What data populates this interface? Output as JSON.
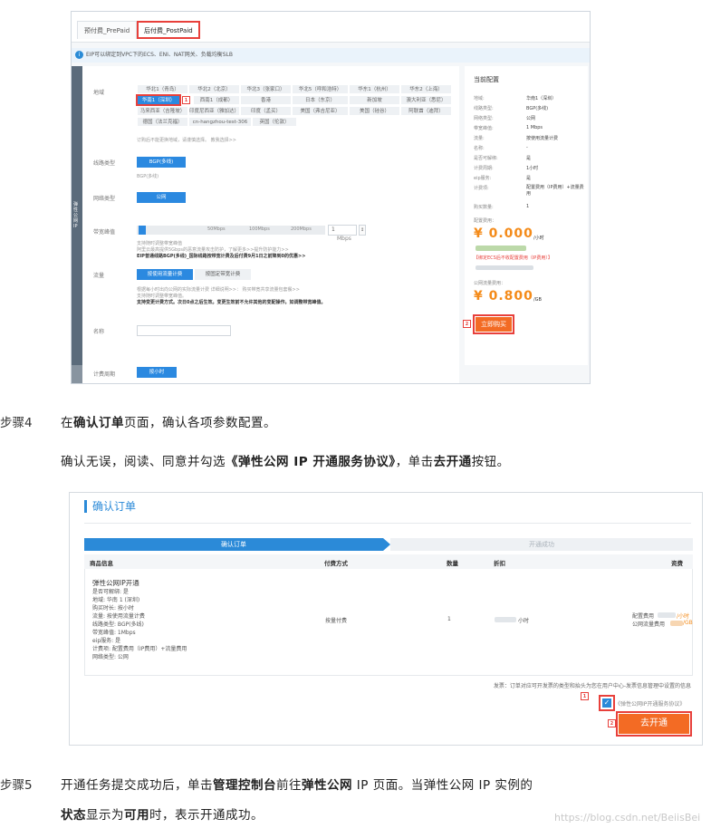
{
  "shot1": {
    "tabs": [
      "预付费_PrePaid",
      "后付费_PostPaid"
    ],
    "notice": "EIP可以绑定到VPC下的ECS、ENI、NAT网关、负载均衡SLB",
    "side_label": "弹性公网IP",
    "labels": {
      "region": "地域",
      "line_type": "线路类型",
      "network_type": "网络类型",
      "bandwidth": "带宽峰值",
      "traffic": "流量",
      "name": "名称",
      "billing_cycle": "计费周期"
    },
    "regions": [
      [
        "华北1（青岛）",
        "华北2（北京）",
        "华北3（张家口）",
        "华北5（呼和浩特）",
        "华东1（杭州）",
        "华东2（上海）"
      ],
      [
        "华南1（深圳）",
        "西南1（成都）",
        "香港",
        "日本（东京）",
        "新加坡",
        "澳大利亚（悉尼）"
      ],
      [
        "马来西亚（吉隆坡）",
        "印度尼西亚（雅加达）",
        "印度（孟买）",
        "美国（弗吉尼亚）",
        "美国（硅谷）",
        "阿联酋（迪拜）"
      ],
      [
        "德国（法兰克福）",
        "cn-hangzhou-test-306",
        "英国（伦敦）"
      ]
    ],
    "region_note": "订购后不能更换地域，请谨慎选择。 教我选择>>",
    "line_btn": "BGP(多线)",
    "line_value": "BGP(多线)",
    "network_btn": "公网",
    "slider_ticks": [
      "50Mbps",
      "100Mbps",
      "200Mbps"
    ],
    "bandwidth_value": "1",
    "bandwidth_unit": "Mbps",
    "bandwidth_hints": [
      "支持随时调整带宽峰值",
      "阿里云最高提供5Gbps的恶意流量攻击防护，了解更多>>提升防护能力>>",
      "EIP普通线路BGP(多线)_国际线路按带宽计费及后付费9月1日之前降到0的优惠>>"
    ],
    "traffic_btns": [
      "按使用流量计费",
      "按固定带宽计费"
    ],
    "traffic_hints": [
      "根据每小时出向公网的实际流量计费 详细说明>>： 购买带宽共享流量包套餐>>",
      "支持随时调整带宽峰值。",
      "支持变更计费方式。次日0点之后生效。变更生效前不允许其他的变配操作。如调整带宽峰值。"
    ],
    "billing_btn": "按小时",
    "summary": {
      "title": "当前配置",
      "rows": [
        [
          "地域:",
          "华南1（深圳）"
        ],
        [
          "线路类型:",
          "BGP(多线)"
        ],
        [
          "网络类型:",
          "公网"
        ],
        [
          "带宽峰值:",
          "1 Mbps"
        ],
        [
          "流量:",
          "按使用流量计费"
        ],
        [
          "名称:",
          "-"
        ],
        [
          "是否可解绑:",
          "是"
        ],
        [
          "计费周期:",
          "1小时"
        ],
        [
          "eip服务:",
          "是"
        ],
        [
          "计费项:",
          "配置费用（IP费用）+流量费用"
        ],
        [
          "购买数量:",
          "1"
        ]
      ],
      "config_fee_label": "配置费用：",
      "config_price": "¥ 0.000",
      "config_unit": "/小时",
      "warning": "【绑定ECS后不收配置费用（IP费用）】",
      "traffic_fee_label": "公网流量费用：",
      "traffic_price": "¥ 0.800",
      "traffic_unit": "/GB",
      "buy_btn": "立即购买"
    },
    "badge_1": "1",
    "badge_2": "2"
  },
  "step4": {
    "label": "步骤4",
    "line1_pre": "在",
    "line1_bold": "确认订单",
    "line1_post": "页面，确认各项参数配置。",
    "line2_pre": "确认无误，阅读、同意并勾选",
    "line2_bold1": "《弹性公网 IP 开通服务协议》",
    "line2_mid": "，单击",
    "line2_bold2": "去开通",
    "line2_post": "按钮。"
  },
  "shot2": {
    "title": "确认订单",
    "progress": [
      "确认订单",
      "开通成功"
    ],
    "columns": [
      "商品信息",
      "付费方式",
      "数量",
      "折扣",
      "资费"
    ],
    "product_title": "弹性公网IP开通",
    "product_lines": [
      "是否可解绑: 是",
      "地域: 华南 1 (深圳)",
      "购买时长: 按小时",
      "流量: 按使用流量计费",
      "线路类型: BGP(多线)",
      "带宽峰值: 1Mbps",
      "eip服务: 是",
      "计费项: 配置费用（IP费用）+流量费用",
      "网络类型: 公网"
    ],
    "payment": "按量付费",
    "quantity": "1",
    "discount_unit": "小时",
    "fees": [
      "配置费用",
      "公网流量费用"
    ],
    "fee_units": [
      "/小时",
      "/GB"
    ],
    "invoice": "发票：订单对应可开发票的类型和抬头为您在用户中心-发票信息管理中设置的信息",
    "agreement": "《弹性公网IP开通服务协议》",
    "check_mark": "✓",
    "open_btn": "去开通",
    "badge_1": "1",
    "badge_2": "2"
  },
  "step5": {
    "label": "步骤5",
    "line1_pre": "开通任务提交成功后，单击",
    "line1_bold1": "管理控制台",
    "line1_mid": "前往",
    "line1_bold2": "弹性公网",
    "line1_post": " IP 页面。当弹性公网 IP 实例的",
    "line2_bold1": "状态",
    "line2_mid": "显示为",
    "line2_bold2": "可用",
    "line2_post": "时，表示开通成功。"
  },
  "watermark": "https://blog.csdn.net/BeiisBei"
}
